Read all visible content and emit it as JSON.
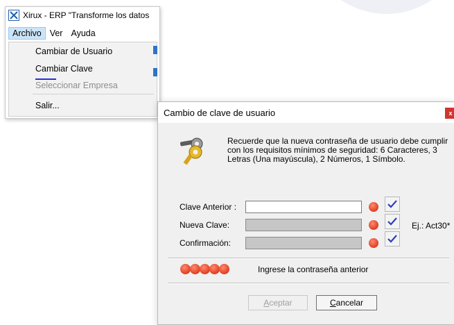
{
  "app_window": {
    "title": "Xirux - ERP \"Transforme los datos",
    "menubar": [
      "Archivo",
      "Ver",
      "Ayuda"
    ],
    "dropdown": {
      "items": [
        {
          "label": "Cambiar de Usuario",
          "enabled": true
        },
        {
          "label": "Cambiar Clave",
          "enabled": true
        },
        {
          "label": "Seleccionar Empresa",
          "enabled": false
        },
        {
          "label": "Salir...",
          "enabled": true
        }
      ]
    }
  },
  "dialog": {
    "title": "Cambio de clave de usuario",
    "close_label": "x",
    "info": "Recuerde que la nueva contraseña de usuario debe cumplir\ncon los requisitos mínimos de seguridad: 6 Caracteres, 3\nLetras (Una mayúscula), 2 Números, 1 Símbolo.",
    "fields": [
      {
        "label": "Clave Anterior :",
        "value": "",
        "enabled": true
      },
      {
        "label": "Nueva Clave:",
        "value": "",
        "enabled": false
      },
      {
        "label": "Confirmación:",
        "value": "",
        "enabled": false
      }
    ],
    "example": "Ej.: Act30*",
    "strength_status": "Ingrese la contraseña anterior",
    "buttons": {
      "accept": {
        "first": "A",
        "rest": "ceptar",
        "enabled": false
      },
      "cancel": {
        "first": "C",
        "rest": "ancelar",
        "enabled": true
      }
    }
  },
  "colors": {
    "status_red": "#e4482c",
    "checkmark_blue": "#2f3fb8",
    "close_red": "#d1342f",
    "menu_highlight": "#cce4f7"
  },
  "icons": [
    "app-logo-icon",
    "key-icon",
    "checkmark-icon",
    "status-dot-icon"
  ]
}
